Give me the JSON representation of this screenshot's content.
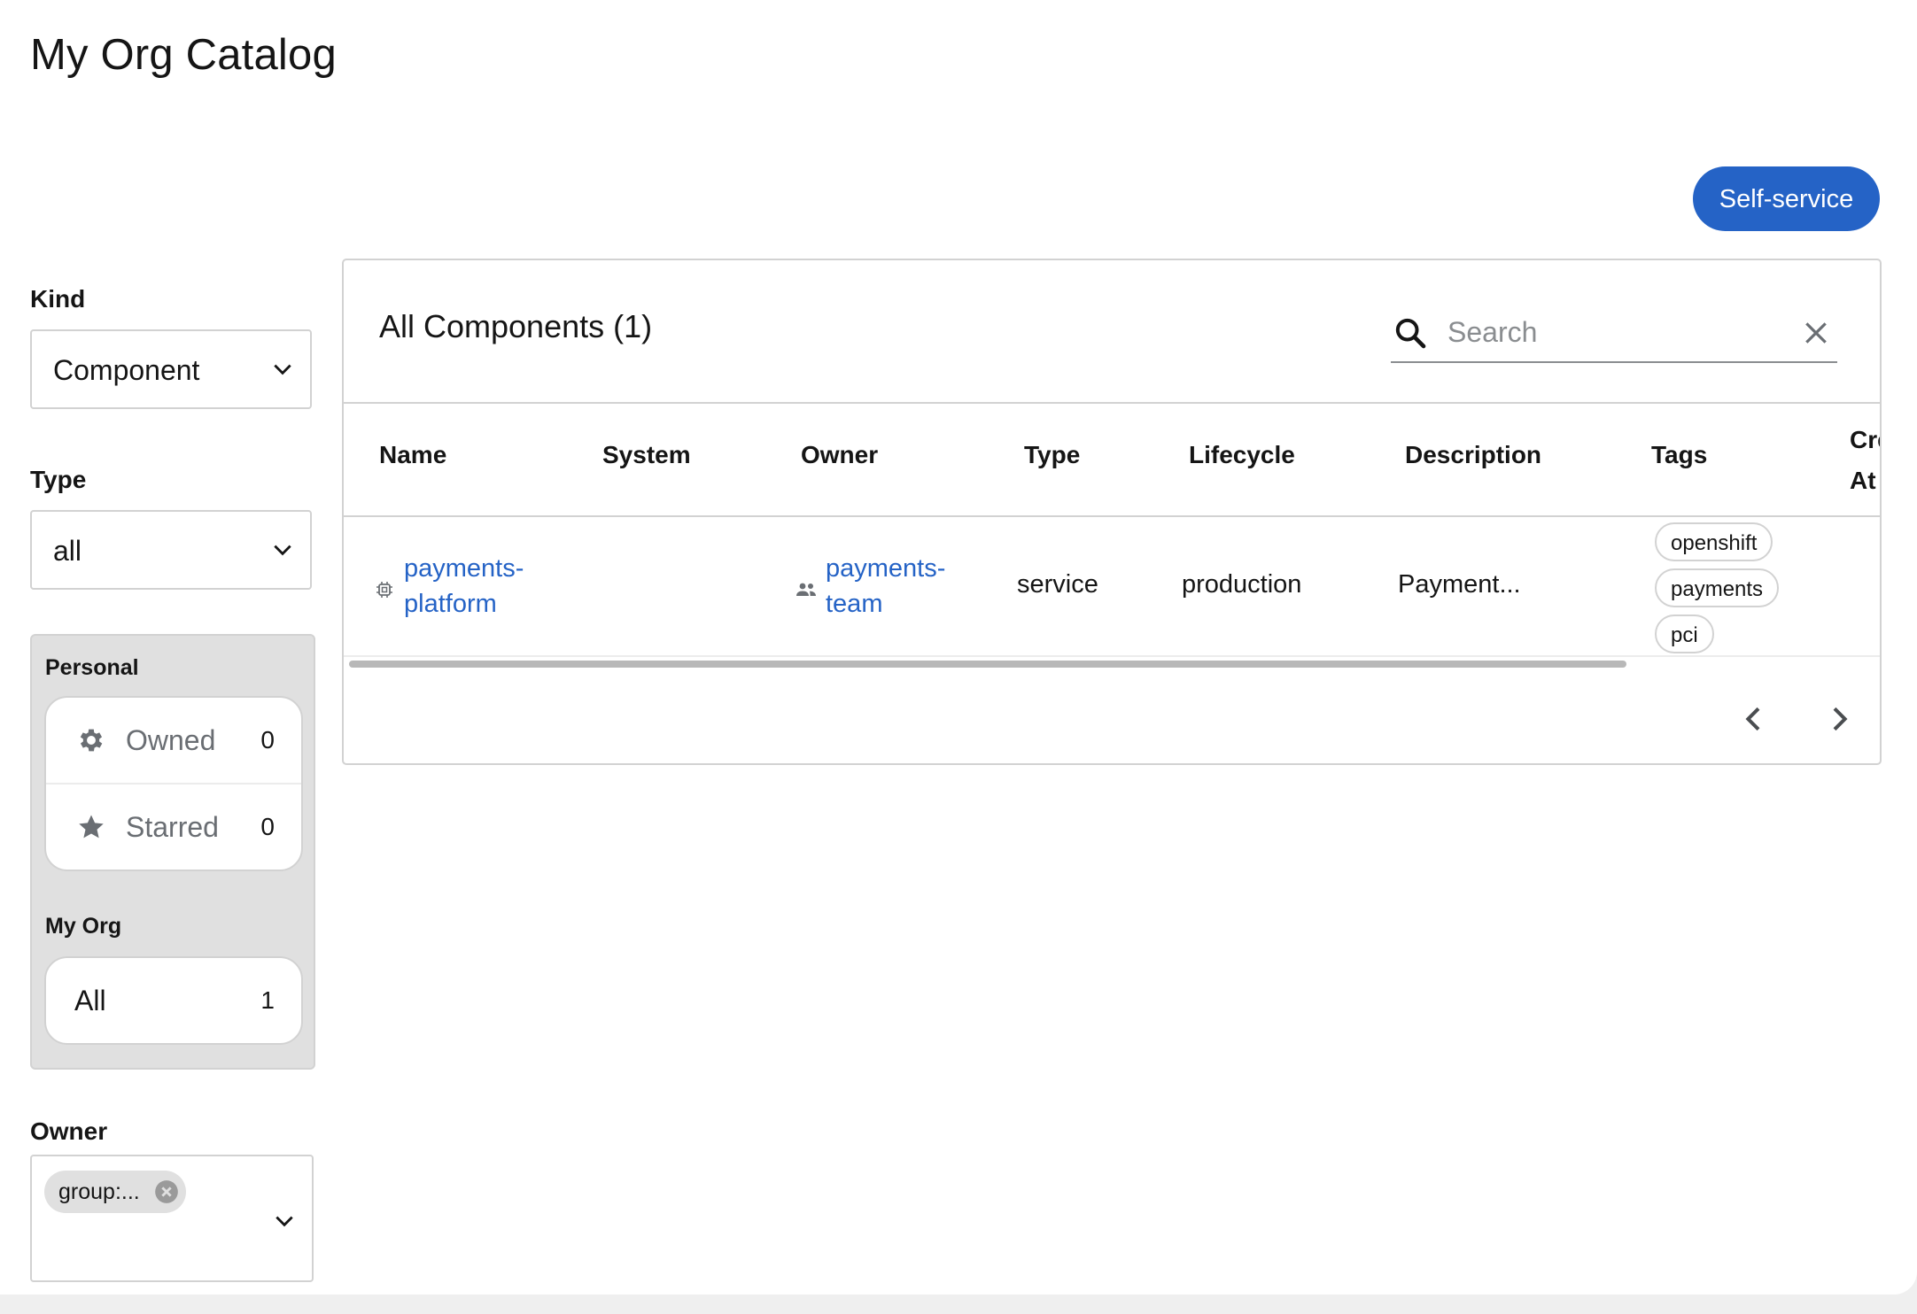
{
  "page": {
    "title": "My Org Catalog"
  },
  "header": {
    "self_service_label": "Self-service"
  },
  "filters": {
    "kind": {
      "label": "Kind",
      "value": "Component"
    },
    "type": {
      "label": "Type",
      "value": "all"
    },
    "personal": {
      "label": "Personal",
      "items": [
        {
          "label": "Owned",
          "count": "0",
          "icon": "gear-icon"
        },
        {
          "label": "Starred",
          "count": "0",
          "icon": "star-icon"
        }
      ]
    },
    "my_org": {
      "label": "My Org",
      "items": [
        {
          "label": "All",
          "count": "1"
        }
      ]
    },
    "owner": {
      "label": "Owner",
      "chip": "group:..."
    }
  },
  "table": {
    "title": "All Components (1)",
    "search_placeholder": "Search",
    "columns": [
      "Name",
      "System",
      "Owner",
      "Type",
      "Lifecycle",
      "Description",
      "Tags",
      "Created At"
    ],
    "rows": [
      {
        "name_line1": "payments-",
        "name_line2": "platform",
        "system": "",
        "owner_line1": "payments-",
        "owner_line2": "team",
        "type": "service",
        "lifecycle": "production",
        "description": "Payment...",
        "tags": [
          "openshift",
          "payments",
          "pci"
        ]
      }
    ]
  },
  "colors": {
    "accent": "#2563c6",
    "panel_bg": "#e0e0e0",
    "border": "#d2d2d2"
  }
}
